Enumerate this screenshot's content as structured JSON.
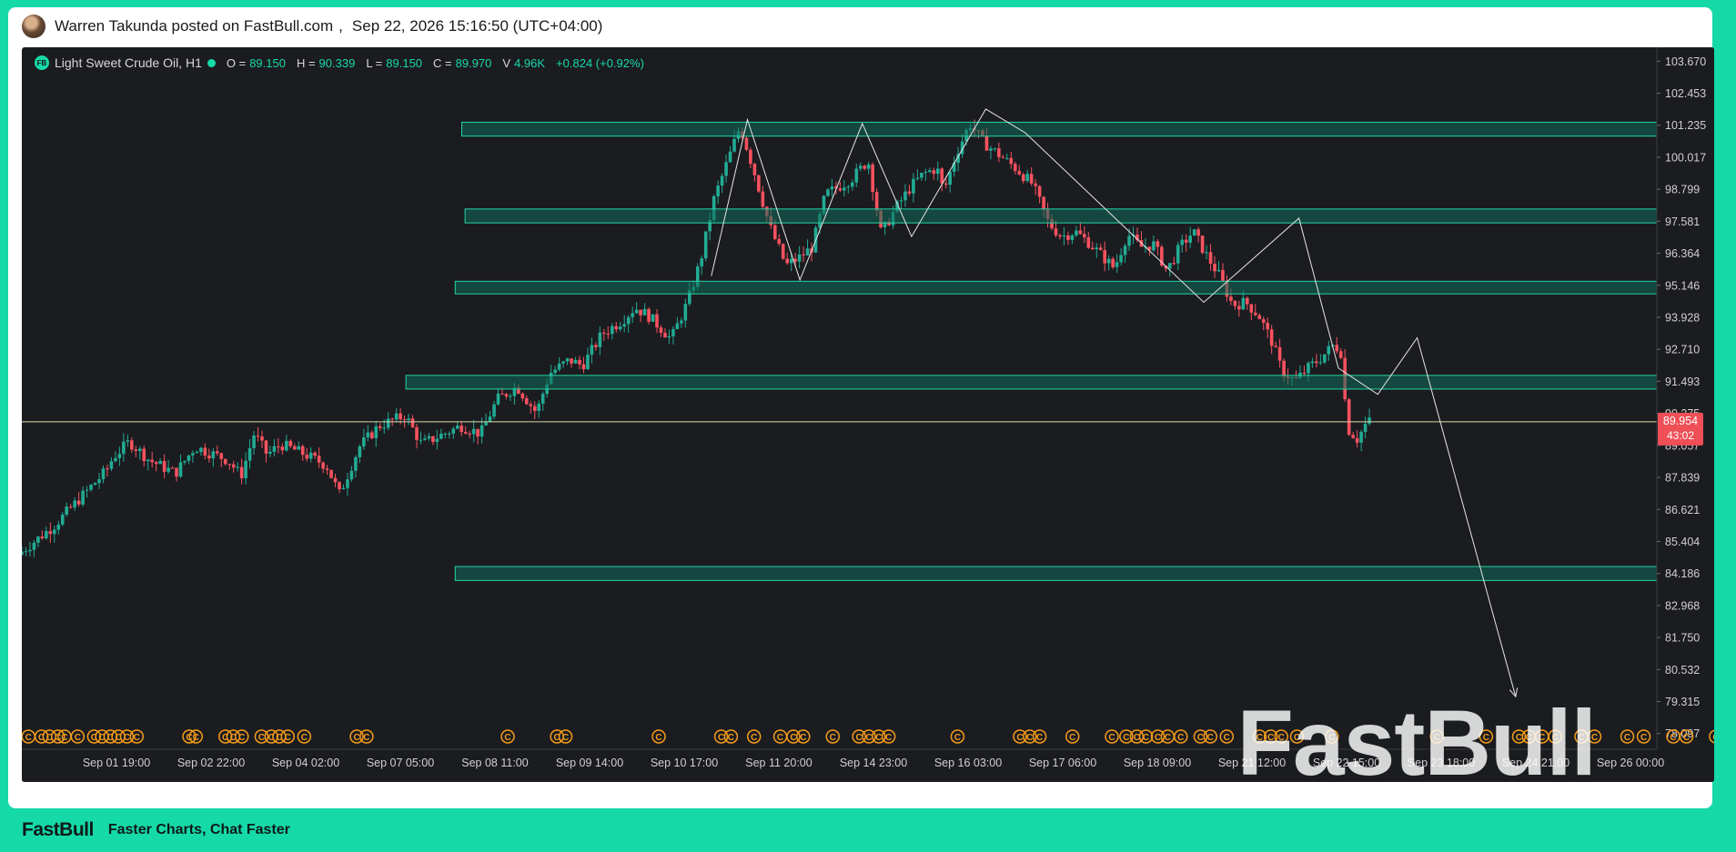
{
  "header": {
    "poster": "Warren Takunda posted on FastBull.com",
    "separator": ",",
    "timestamp": "Sep 22, 2026 15:16:50 (UTC+04:00)"
  },
  "footer": {
    "logo": "FastBull",
    "tagline": "Faster Charts, Chat Faster"
  },
  "legend": {
    "logo_text": "FB",
    "symbol": "Light Sweet Crude Oil, H1",
    "o_label": "O =",
    "o_value": "89.150",
    "h_label": "H =",
    "h_value": "90.339",
    "l_label": "L =",
    "l_value": "89.150",
    "c_label": "C =",
    "c_value": "89.970",
    "v_label": "V",
    "v_value": "4.96K",
    "change": "+0.824 (+0.92%)"
  },
  "watermark": "FastBull",
  "colors": {
    "up": "#22ab94",
    "down": "#f7525f",
    "zone_fill": "#0f6b5a",
    "zone_border": "#24d4a4",
    "accent": "#16d9a8",
    "price_tag": "#ef4f57",
    "price_line": "#d9d9a6",
    "event_icon": "#f59c1a",
    "pattern_line": "#e6e6e6"
  },
  "chart_data": {
    "type": "candlestick",
    "symbol": "Light Sweet Crude Oil",
    "timeframe": "H1",
    "ylim": [
      77.5,
      104.2
    ],
    "y_ticks": [
      "103.670",
      "102.453",
      "101.235",
      "100.017",
      "98.799",
      "97.581",
      "96.364",
      "95.146",
      "93.928",
      "92.710",
      "91.493",
      "90.275",
      "89.057",
      "87.839",
      "86.621",
      "85.404",
      "84.186",
      "82.968",
      "81.750",
      "80.532",
      "79.315",
      "78.097"
    ],
    "x_ticks": [
      "Sep 01 19:00",
      "Sep 02 22:00",
      "Sep 04 02:00",
      "Sep 07 05:00",
      "Sep 08 11:00",
      "Sep 09 14:00",
      "Sep 10 17:00",
      "Sep 11 20:00",
      "Sep 14 23:00",
      "Sep 16 03:00",
      "Sep 17 06:00",
      "Sep 18 09:00",
      "Sep 21 12:00",
      "Sep 22 15:00",
      "Sep 23 18:00",
      "Sep 24 21:00",
      "Sep 26 00:00"
    ],
    "x_range": [
      -7.6,
      17.3
    ],
    "current_price": "89.954",
    "current_price_value": 89.954,
    "countdown": "43:02",
    "path": [
      [
        -7.6,
        84.9
      ],
      [
        -7.05,
        86.0
      ],
      [
        -6.25,
        88.1
      ],
      [
        -6.15,
        88.6
      ],
      [
        -5.9,
        89.2
      ],
      [
        -5.6,
        88.5
      ],
      [
        -5.2,
        88.0
      ],
      [
        -4.9,
        89.0
      ],
      [
        -4.4,
        88.5
      ],
      [
        -4.2,
        87.9
      ],
      [
        -4.0,
        89.5
      ],
      [
        -3.8,
        88.7
      ],
      [
        -3.6,
        89.1
      ],
      [
        -3.3,
        88.8
      ],
      [
        -2.9,
        88.3
      ],
      [
        -2.7,
        87.2
      ],
      [
        -2.4,
        89.0
      ],
      [
        -2.1,
        89.8
      ],
      [
        -1.7,
        90.2
      ],
      [
        -1.45,
        89.1
      ],
      [
        -0.85,
        89.8
      ],
      [
        -0.55,
        89.5
      ],
      [
        -0.3,
        90.8
      ],
      [
        0.0,
        91.3
      ],
      [
        0.3,
        90.3
      ],
      [
        0.5,
        91.8
      ],
      [
        0.8,
        92.3
      ],
      [
        1.0,
        92.1
      ],
      [
        1.3,
        93.3
      ],
      [
        1.6,
        93.8
      ],
      [
        1.8,
        94.3
      ],
      [
        2.0,
        94.0
      ],
      [
        2.2,
        93.5
      ],
      [
        2.35,
        93.1
      ],
      [
        2.6,
        94.5
      ],
      [
        2.8,
        96.1
      ],
      [
        3.0,
        98.4
      ],
      [
        3.2,
        99.8
      ],
      [
        3.4,
        101.2
      ],
      [
        3.6,
        99.6
      ],
      [
        3.85,
        97.4
      ],
      [
        4.1,
        95.9
      ],
      [
        4.3,
        96.2
      ],
      [
        4.5,
        96.6
      ],
      [
        4.7,
        98.6
      ],
      [
        4.9,
        98.9
      ],
      [
        5.1,
        99.2
      ],
      [
        5.35,
        99.9
      ],
      [
        5.55,
        97.1
      ],
      [
        5.75,
        98.0
      ],
      [
        6.0,
        98.9
      ],
      [
        6.2,
        99.4
      ],
      [
        6.4,
        99.6
      ],
      [
        6.5,
        98.7
      ],
      [
        6.7,
        100.2
      ],
      [
        6.9,
        101.3
      ],
      [
        7.1,
        100.6
      ],
      [
        7.3,
        100.2
      ],
      [
        7.6,
        99.6
      ],
      [
        7.85,
        99.0
      ],
      [
        8.1,
        97.5
      ],
      [
        8.3,
        97.0
      ],
      [
        8.5,
        97.2
      ],
      [
        8.7,
        96.8
      ],
      [
        8.9,
        96.3
      ],
      [
        9.1,
        95.8
      ],
      [
        9.3,
        97.1
      ],
      [
        9.5,
        96.6
      ],
      [
        9.7,
        96.7
      ],
      [
        9.9,
        95.7
      ],
      [
        10.1,
        96.6
      ],
      [
        10.3,
        97.2
      ],
      [
        10.5,
        96.3
      ],
      [
        10.7,
        95.5
      ],
      [
        10.9,
        94.4
      ],
      [
        11.1,
        94.5
      ],
      [
        11.3,
        94.0
      ],
      [
        11.5,
        93.0
      ],
      [
        11.65,
        91.9
      ],
      [
        11.85,
        91.5
      ],
      [
        12.05,
        92.0
      ],
      [
        12.25,
        92.4
      ],
      [
        12.45,
        92.9
      ],
      [
        12.55,
        92.6
      ],
      [
        12.65,
        89.7
      ],
      [
        12.8,
        89.3
      ],
      [
        12.95,
        89.97
      ]
    ],
    "zones": [
      {
        "top": 101.35,
        "bottom": 100.82,
        "x_start": -0.9,
        "x_end": 18.8
      },
      {
        "top": 98.05,
        "bottom": 97.52,
        "x_start": -0.85,
        "x_end": 18.9
      },
      {
        "top": 95.3,
        "bottom": 94.82,
        "x_start": -1.0,
        "x_end": 18.8
      },
      {
        "top": 91.72,
        "bottom": 91.2,
        "x_start": -1.75,
        "x_end": 18.0
      },
      {
        "top": 84.45,
        "bottom": 83.92,
        "x_start": -1.0,
        "x_end": 18.8
      }
    ],
    "pattern": [
      [
        2.9,
        95.5
      ],
      [
        3.45,
        101.45
      ],
      [
        4.25,
        95.35
      ],
      [
        5.2,
        101.3
      ],
      [
        5.95,
        97.0
      ],
      [
        7.08,
        101.85
      ],
      [
        7.68,
        100.95
      ],
      [
        10.4,
        94.5
      ],
      [
        11.85,
        97.7
      ],
      [
        12.45,
        92.0
      ],
      [
        13.05,
        91.0
      ],
      [
        13.65,
        93.15
      ],
      [
        15.15,
        79.5
      ]
    ],
    "events": [
      -7.5,
      -7.3,
      -7.18,
      -7.05,
      -6.95,
      -6.75,
      -6.5,
      -6.38,
      -6.25,
      -6.13,
      -6.0,
      -5.85,
      -5.05,
      -4.95,
      -4.5,
      -4.38,
      -4.25,
      -3.95,
      -3.8,
      -3.68,
      -3.55,
      -3.3,
      -2.5,
      -2.35,
      -0.2,
      0.55,
      0.68,
      2.1,
      3.05,
      3.2,
      3.55,
      3.95,
      4.15,
      4.3,
      4.75,
      5.15,
      5.3,
      5.45,
      5.6,
      6.65,
      7.6,
      7.75,
      7.9,
      8.4,
      9.0,
      9.22,
      9.38,
      9.52,
      9.7,
      9.85,
      10.05,
      10.35,
      10.5,
      10.75,
      11.25,
      11.42,
      11.58,
      11.82,
      12.35,
      13.95,
      14.7,
      15.2,
      15.35,
      15.55,
      15.75,
      16.15,
      16.35,
      16.85,
      17.1,
      17.55,
      17.75,
      18.2,
      18.7,
      18.9,
      19.2
    ]
  }
}
